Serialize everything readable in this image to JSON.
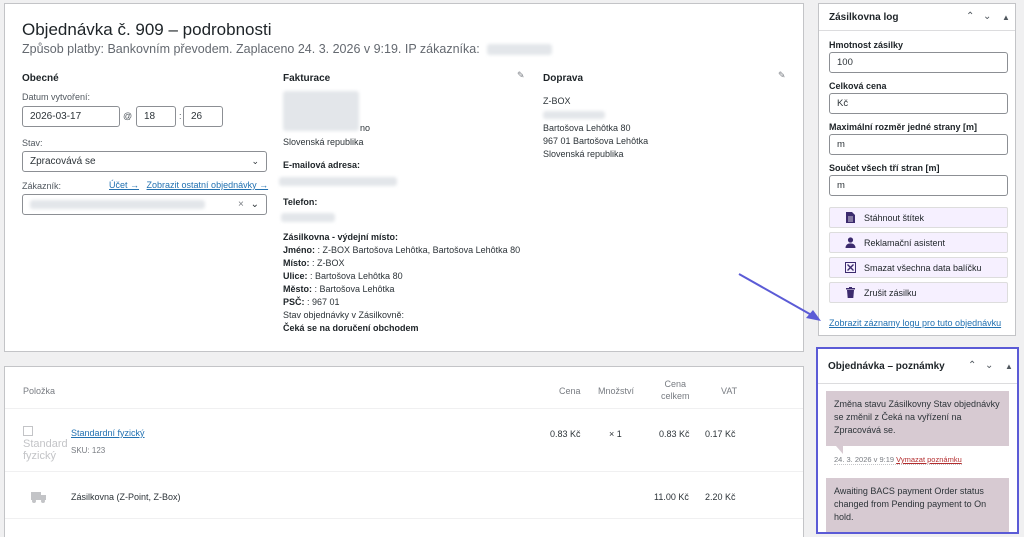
{
  "order": {
    "title": "Objednávka č. 909 – podrobnosti",
    "subtitle": "Způsob platby: Bankovním převodem. Zaplaceno 24. 3. 2026 v 9:19. IP zákazníka:"
  },
  "general": {
    "heading": "Obecné",
    "date_label": "Datum vytvoření:",
    "date_value": "2026-03-17",
    "at_sign": "@",
    "hour": "18",
    "colon": ":",
    "minute": "26",
    "status_label": "Stav:",
    "status_value": "Zpracovává se",
    "customer_label": "Zákazník:",
    "account_link": "Účet →",
    "other_orders_link": "Zobrazit ostatní objednávky →",
    "clear_icon": "×"
  },
  "billing": {
    "heading": "Fakturace",
    "partial_line": "no",
    "country": "Slovenská republika",
    "email_label": "E-mailová adresa:",
    "phone_label": "Telefon:",
    "pickup_heading": "Zásilkovna - výdejní místo:",
    "pickup": [
      {
        "label": "Jméno:",
        "value": " : Z-BOX Bartošova Lehôtka, Bartošova Lehôtka 80"
      },
      {
        "label": "Místo:",
        "value": " : Z-BOX"
      },
      {
        "label": "Ulice:",
        "value": " : Bartošova Lehôtka 80"
      },
      {
        "label": "Město:",
        "value": " : Bartošova Lehôtka"
      },
      {
        "label": "PSČ:",
        "value": " : 967 01"
      }
    ],
    "status_heading": "Stav objednávky v Zásilkovně:",
    "status_value": "Čeká se na doručení obchodem"
  },
  "shipping": {
    "heading": "Doprava",
    "lines": [
      "Z-BOX",
      "Bartošova Lehôtka 80",
      "967 01 Bartošova Lehôtka",
      "Slovenská republika"
    ]
  },
  "items": {
    "headers": {
      "item": "Položka",
      "price": "Cena",
      "qty": "Množství",
      "total_line1": "Cena",
      "total_line2": "celkem",
      "vat": "VAT"
    },
    "rows": [
      {
        "image_alt": "Standardní fyzický",
        "name": "Standardní fyzický",
        "sku": "SKU: 123",
        "price": "0.83 Kč",
        "qty": "× 1",
        "total": "0.83 Kč",
        "vat": "0.17 Kč"
      }
    ],
    "shipping_row": {
      "name": "Zásilkovna (Z-Point, Z-Box)",
      "total": "11.00 Kč",
      "vat": "2.20 Kč"
    }
  },
  "log_box": {
    "title": "Zásilkovna log",
    "weight_label": "Hmotnost zásilky",
    "weight_value": "100",
    "price_label": "Celková cena",
    "price_value": "Kč",
    "maxdim_label": "Maximální rozměr jedné strany [m]",
    "maxdim_value": "m",
    "sumdim_label": "Součet všech tří stran [m]",
    "sumdim_value": "m",
    "buttons": [
      {
        "label": "Stáhnout štítek",
        "icon": "document-icon"
      },
      {
        "label": "Reklamační asistent",
        "icon": "user-icon"
      },
      {
        "label": "Smazat všechna data balíčku",
        "icon": "delete-box-icon"
      },
      {
        "label": "Zrušit zásilku",
        "icon": "trash-icon"
      }
    ],
    "log_link": "Zobrazit záznamy logu pro tuto objednávku"
  },
  "notes_box": {
    "title": "Objednávka – poznámky",
    "notes": [
      {
        "text": "Změna stavu Zásilkovny Stav objednávky se změnil z Čeká na vyřízení na Zpracovává se.",
        "date": "24. 3. 2026 v 9:19",
        "delete": "Vymazat poznámku"
      },
      {
        "text": "Awaiting BACS payment Order status changed from Pending payment to On hold."
      }
    ]
  },
  "colors": {
    "accent": "#2271b1",
    "highlight_border": "#5b5bd6",
    "note_bg": "#d7cad2",
    "button_bg": "#f6f0ff"
  }
}
